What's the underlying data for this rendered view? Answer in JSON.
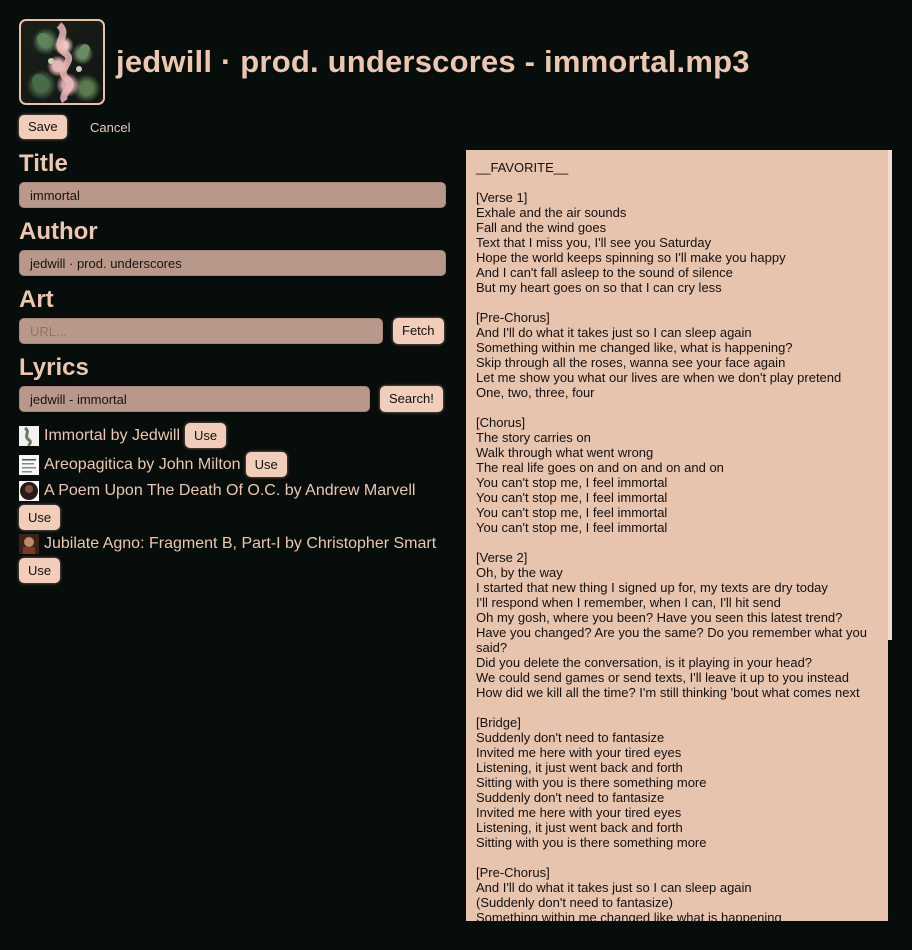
{
  "header": {
    "title": "jedwill · prod. underscores - immortal.mp3",
    "cover_icon": "album-art"
  },
  "actions": {
    "save": "Save",
    "cancel": "Cancel"
  },
  "fields": {
    "title_label": "Title",
    "title_value": "immortal",
    "author_label": "Author",
    "author_value": "jedwill · prod. underscores",
    "art_label": "Art",
    "art_placeholder": "URL...",
    "fetch": "Fetch",
    "lyrics_label": "Lyrics",
    "lyrics_query": "jedwill - immortal",
    "search": "Search!"
  },
  "results": [
    {
      "text": "Immortal by Jedwill",
      "use": "Use"
    },
    {
      "text": "Areopagitica by John Milton",
      "use": "Use"
    },
    {
      "text": "A Poem Upon The Death Of O.C. by Andrew Marvell",
      "use": "Use"
    },
    {
      "text": "Jubilate Agno: Fragment B, Part-I by Christopher Smart",
      "use": "Use"
    }
  ],
  "lyrics": "__FAVORITE__\n\n[Verse 1]\nExhale and the air sounds\nFall and the wind goes\nText that I miss you, I'll see you Saturday\nHope the world keeps spinning so I'll make you happy\nAnd I can't fall asleep to the sound of silence\nBut my heart goes on so that I can cry less\n\n[Pre-Chorus]\nAnd I'll do what it takes just so I can sleep again\nSomething within me changed like, what is happening?\nSkip through all the roses, wanna see your face again\nLet me show you what our lives are when we don't play pretend\nOne, two, three, four\n\n[Chorus]\nThe story carries on\nWalk through what went wrong\nThe real life goes on and on and on and on\nYou can't stop me, I feel immortal\nYou can't stop me, I feel immortal\nYou can't stop me, I feel immortal\nYou can't stop me, I feel immortal\n\n[Verse 2]\nOh, by the way\nI started that new thing I signed up for, my texts are dry today\nI'll respond when I remember, when I can, I'll hit send\nOh my gosh, where you been? Have you seen this latest trend?\nHave you changed? Are you the same? Do you remember what you said?\nDid you delete the conversation, is it playing in your head?\nWe could send games or send texts, I'll leave it up to you instead\nHow did we kill all the time? I'm still thinking 'bout what comes next\n\n[Bridge]\nSuddenly don't need to fantasize\nInvited me here with your tired eyes\nListening, it just went back and forth\nSitting with you is there something more\nSuddenly don't need to fantasize\nInvited me here with your tired eyes\nListening, it just went back and forth\nSitting with you is there something more\n\n[Pre-Chorus]\nAnd I'll do what it takes just so I can sleep again\n(Suddenly don't need to fantasize)\nSomething within me changed like what is happening"
}
